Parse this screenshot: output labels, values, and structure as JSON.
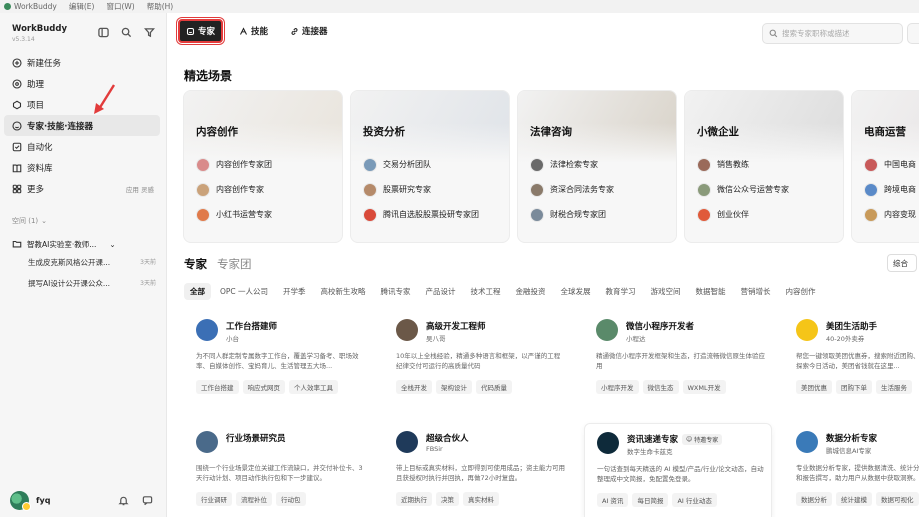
{
  "menubar": {
    "app_name": "WorkBuddy",
    "items": [
      "编辑(E)",
      "窗口(W)",
      "帮助(H)"
    ]
  },
  "sidebar": {
    "brand": "WorkBuddy",
    "version": "v5.3.14",
    "nav": [
      {
        "label": "新建任务",
        "icon": "plus-circle-icon"
      },
      {
        "label": "助理",
        "icon": "assistant-icon"
      },
      {
        "label": "项目",
        "icon": "project-icon"
      },
      {
        "label": "专家·技能·连接器",
        "icon": "expert-icon",
        "active": true
      },
      {
        "label": "自动化",
        "icon": "automation-icon"
      },
      {
        "label": "资料库",
        "icon": "library-icon"
      },
      {
        "label": "更多",
        "icon": "more-icon",
        "extra": "应用 灵感"
      }
    ],
    "space_label": "空间 (1)",
    "space_folder": "智教AI实验室·教师...",
    "tasks": [
      {
        "title": "生成皮克斯风格公开课...",
        "when": "3天前"
      },
      {
        "title": "撰写AI设计公开课公众...",
        "when": "3天前"
      }
    ],
    "user_name": "fyq"
  },
  "main": {
    "tabs": [
      {
        "label": "专家",
        "icon": "expert-icon",
        "active": true
      },
      {
        "label": "技能",
        "icon": "skill-icon"
      },
      {
        "label": "连接器",
        "icon": "link-icon"
      }
    ],
    "search_placeholder": "搜索专家职称或描述",
    "section_title": "精选场景",
    "scenes": [
      {
        "title": "内容创作",
        "bg": "#e9e4dc",
        "items": [
          {
            "name": "内容创作专家团",
            "color": "#d98b8b"
          },
          {
            "name": "内容创作专家",
            "color": "#caa27a"
          },
          {
            "name": "小红书运营专家",
            "color": "#e07a4a"
          }
        ]
      },
      {
        "title": "投资分析",
        "bg": "#dfe3e8",
        "items": [
          {
            "name": "交易分析团队",
            "color": "#7a9ab8"
          },
          {
            "name": "股票研究专家",
            "color": "#b58a6a"
          },
          {
            "name": "腾讯自选股股票投研专家团",
            "color": "#d94a3a"
          }
        ]
      },
      {
        "title": "法律咨询",
        "bg": "#d8d2c8",
        "items": [
          {
            "name": "法律检索专家",
            "color": "#6a6a6a"
          },
          {
            "name": "资深合同法务专家",
            "color": "#8a7a6a"
          },
          {
            "name": "财税合规专家团",
            "color": "#7a8a9a"
          }
        ]
      },
      {
        "title": "小微企业",
        "bg": "#dcdcdc",
        "items": [
          {
            "name": "销售教练",
            "color": "#9a6a5a"
          },
          {
            "name": "微信公众号运营专家",
            "color": "#8a9a7a"
          },
          {
            "name": "创业伙伴",
            "color": "#e05a3a"
          }
        ]
      },
      {
        "title": "电商运营",
        "bg": "#e4dfe0",
        "items": [
          {
            "name": "中国电商",
            "color": "#c85a5a"
          },
          {
            "name": "跨境电商",
            "color": "#5a8ac8"
          },
          {
            "name": "内容变现",
            "color": "#c89a5a"
          }
        ]
      }
    ],
    "experts_tab": "专家",
    "teams_tab": "专家团",
    "sort_label": "综合",
    "filters": [
      "全部",
      "OPC 一人公司",
      "开学季",
      "高校新生攻略",
      "腾讯专家",
      "产品设计",
      "技术工程",
      "金融投资",
      "全球发展",
      "教育学习",
      "游戏空间",
      "数据智能",
      "营销增长",
      "内容创作"
    ],
    "cards": [
      {
        "name": "工作台搭建师",
        "sub": "小台",
        "desc": "为不同人群定制专属数字工作台，覆盖学习备考、职场效率、自媒体创作、宝妈育儿、生活管理五大场...",
        "tags": [
          "工作台搭建",
          "响应式网页",
          "个人效率工具"
        ],
        "color": "#3b6fb5"
      },
      {
        "name": "高级开发工程师",
        "sub": "吴八哥",
        "desc": "10年以上全栈经验，精通多种语言和框架，以严谨的工程纪律交付可运行的高质量代码",
        "tags": [
          "全栈开发",
          "架构设计",
          "代码质量"
        ],
        "color": "#6b5848"
      },
      {
        "name": "微信小程序开发者",
        "sub": "小程达",
        "desc": "精通微信小程序开发框架和生态，打造流畅微信原生体验应用",
        "tags": [
          "小程序开发",
          "微信生态",
          "WXML开发"
        ],
        "color": "#5a8a6a"
      },
      {
        "name": "美团生活助手",
        "sub": "40-20外卖券",
        "desc": "帮您一键领取美团优惠券，搜索附近团购、外卖吃喝玩乐，探索今日活动，美团省钱就在这里...",
        "tags": [
          "美团优惠",
          "团购下单",
          "生活服务"
        ],
        "color": "#f5c518"
      },
      {
        "name": "行业场景研究员",
        "sub": "",
        "desc": "围绕一个行业场景定位关键工作流缺口，并交付补位卡、3天行动计划、项目动作执行包和下一步建议。",
        "tags": [
          "行业调研",
          "流程补位",
          "行动包"
        ],
        "color": "#4a6a8a"
      },
      {
        "name": "超级合伙人",
        "sub": "FBSir",
        "desc": "带上目标或真实材料，立即得到可使用成品；资主能力可用且获授权时执行并回执，再做72小时复盘。",
        "tags": [
          "近期执行",
          "决策",
          "真实材料"
        ],
        "color": "#1f3a5a"
      },
      {
        "name": "资讯速递专家",
        "sub": "数字生命卡兹克",
        "badge": "特邀专家",
        "desc": "一句话查到每天精选的 AI 模型/产品/行业/论文动态，自动整理成中文简报，免配置免登录。",
        "tags": [
          "AI 资讯",
          "每日简报",
          "AI 行业动态"
        ],
        "color": "#0e2a3a"
      },
      {
        "name": "数据分析专家",
        "sub": "鹏城信息AI专家",
        "desc": "专业数据分析专家，提供数据清洗、统计分析、可视化分析和报告撰写，助力用户从数据中获取洞察。",
        "tags": [
          "数据分析",
          "统计建模",
          "数据可视化"
        ],
        "color": "#3a7ab8"
      }
    ]
  }
}
